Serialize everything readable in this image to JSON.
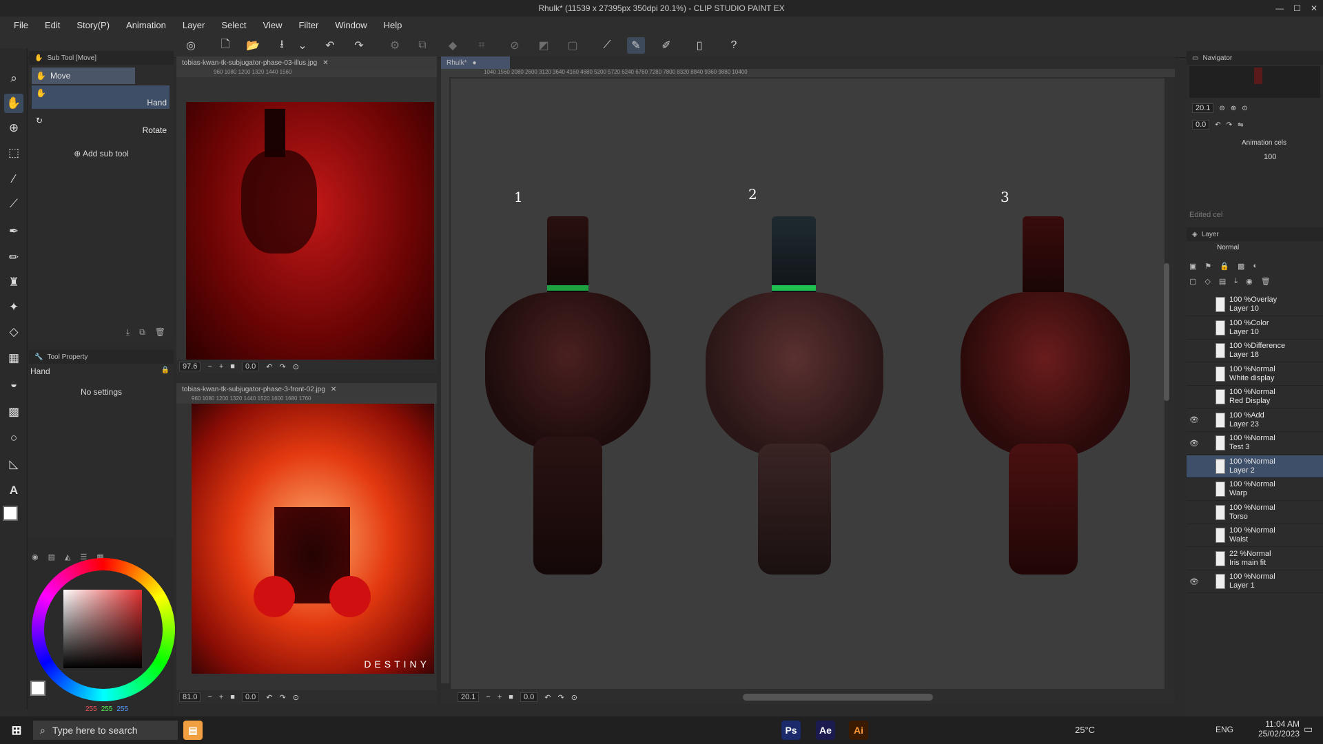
{
  "window": {
    "title": "Rhulk* (11539 x 27395px 350dpi 20.1%)  - CLIP STUDIO PAINT EX",
    "controls": [
      "—",
      "☐",
      "✕"
    ]
  },
  "menu": [
    "File",
    "Edit",
    "Story(P)",
    "Animation",
    "Layer",
    "Select",
    "View",
    "Filter",
    "Window",
    "Help"
  ],
  "subtool": {
    "panel_title": "Sub Tool [Move]",
    "items": [
      {
        "label": "Move"
      },
      {
        "label": "Hand"
      },
      {
        "label": "Rotate"
      }
    ],
    "add_label": "Add sub tool"
  },
  "toolprop": {
    "panel_title": "Tool Property",
    "tool_name": "Hand",
    "empty_text": "No settings"
  },
  "color": {
    "r": "255",
    "g": "255",
    "b": "255"
  },
  "ref1": {
    "tab": "tobias-kwan-tk-subjugator-phase-03-illus.jpg",
    "ruler": "960  1080  1200  1320  1440  1560",
    "zoom": "97.6",
    "angle": "0.0"
  },
  "ref2": {
    "tab": "tobias-kwan-tk-subjugator-phase-3-front-02.jpg",
    "ruler": "960 1080 1200 1320 1440 1520 1600 1680 1760",
    "zoom": "81.0",
    "angle": "0.0",
    "caption": "DESTINY"
  },
  "canvas": {
    "tab": "Rhulk*",
    "ruler": "1040   1560   2080   2600   3120   3640   4160   4680   5200   5720   6240   6760   7280   7800   8320   8840   9360   9880   10400",
    "zoom": "20.1",
    "angle": "0.0",
    "labels": [
      "1",
      "2",
      "3"
    ]
  },
  "navigator": {
    "title": "Navigator",
    "zoom": "20.1",
    "angle": "0.0",
    "anim_title": "Animation cels",
    "opacity": "100",
    "edited_cel": "Edited cel"
  },
  "layers": {
    "title": "Layer",
    "blend_mode": "Normal",
    "rows": [
      {
        "line1": "100 %Overlay",
        "line2": "Layer 10",
        "visible": false,
        "selected": false
      },
      {
        "line1": "100 %Color",
        "line2": "Layer 10",
        "visible": false,
        "selected": false
      },
      {
        "line1": "100 %Difference",
        "line2": "Layer 18",
        "visible": false,
        "selected": false
      },
      {
        "line1": "100 %Normal",
        "line2": "White display",
        "visible": false,
        "selected": false
      },
      {
        "line1": "100 %Normal",
        "line2": "Red Display",
        "visible": false,
        "selected": false
      },
      {
        "line1": "100 %Add",
        "line2": "Layer 23",
        "visible": true,
        "selected": false
      },
      {
        "line1": "100 %Normal",
        "line2": "Test 3",
        "visible": true,
        "selected": false
      },
      {
        "line1": "100 %Normal",
        "line2": "Layer 2",
        "visible": false,
        "selected": true
      },
      {
        "line1": "100 %Normal",
        "line2": "Warp",
        "visible": false,
        "selected": false
      },
      {
        "line1": "100 %Normal",
        "line2": "Torso",
        "visible": false,
        "selected": false
      },
      {
        "line1": "100 %Normal",
        "line2": "Waist",
        "visible": false,
        "selected": false
      },
      {
        "line1": "22 %Normal",
        "line2": "Iris main fit",
        "visible": false,
        "selected": false
      },
      {
        "line1": "100 %Normal",
        "line2": "Layer 1",
        "visible": true,
        "selected": false
      }
    ]
  },
  "taskbar": {
    "search_placeholder": "Type here to search",
    "temperature": "25°C",
    "language": "ENG",
    "time": "11:04 AM",
    "date": "25/02/2023",
    "apps": [
      "Ps",
      "Ae",
      "Ai"
    ]
  }
}
